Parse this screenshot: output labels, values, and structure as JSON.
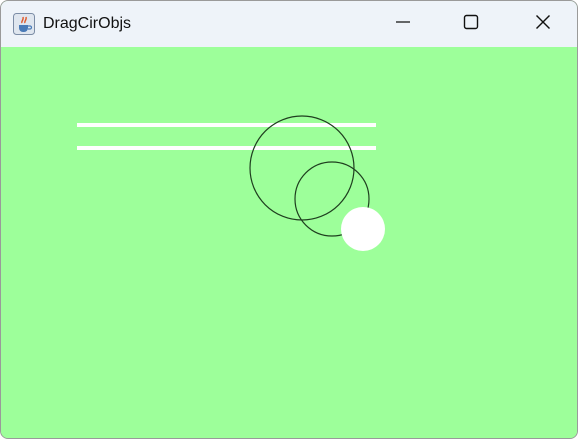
{
  "window": {
    "title": "DragCirObjs",
    "app_icon": "java-cup-icon",
    "controls": {
      "minimize_icon": "minimize-icon",
      "maximize_icon": "maximize-icon",
      "close_icon": "close-icon"
    }
  },
  "canvas": {
    "background_color": "#9dff9a",
    "line_color": "#ffffff",
    "circle_outline_color": "#1f3f1f",
    "filled_circle_color": "#ffffff"
  }
}
